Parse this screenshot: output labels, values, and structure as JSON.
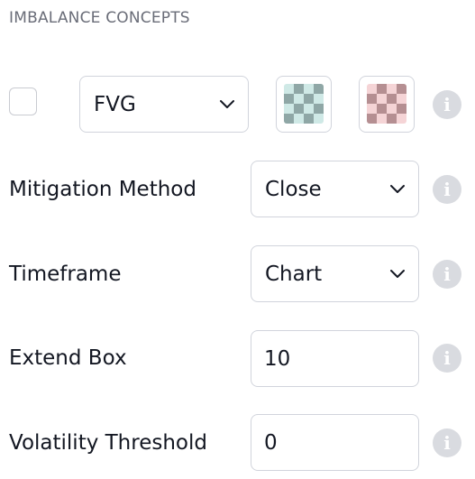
{
  "section": {
    "title": "IMBALANCE CONCEPTS"
  },
  "row_fvg": {
    "checkbox_checked": false,
    "select_value": "FVG",
    "bull_color_icon": "checker-swatch-teal",
    "bear_color_icon": "checker-swatch-red",
    "bull_colors": [
      "#cfe9e6",
      "#8fa7a6"
    ],
    "bear_colors": [
      "#f5d4d6",
      "#b58f92"
    ],
    "info_glyph": "i"
  },
  "row_mitigation": {
    "label": "Mitigation Method",
    "select_value": "Close",
    "info_glyph": "i"
  },
  "row_timeframe": {
    "label": "Timeframe",
    "select_value": "Chart",
    "info_glyph": "i"
  },
  "row_extend": {
    "label": "Extend Box",
    "input_value": "10",
    "info_glyph": "i"
  },
  "row_volatility": {
    "label": "Volatility Threshold",
    "input_value": "0",
    "info_glyph": "i"
  }
}
